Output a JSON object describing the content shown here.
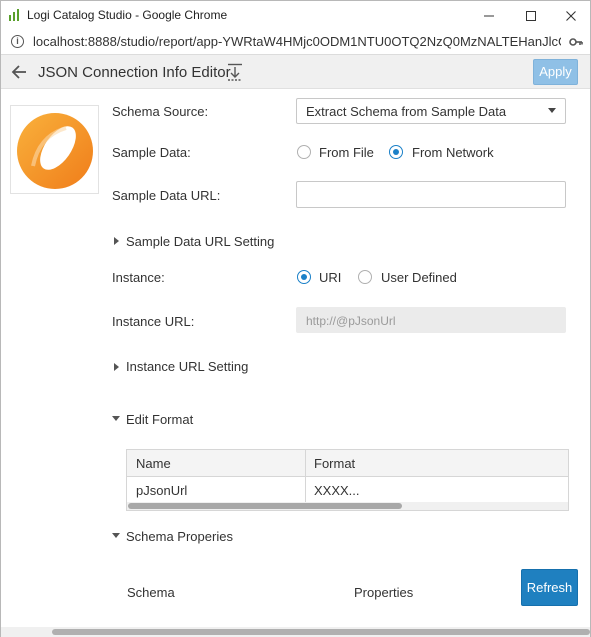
{
  "window": {
    "title": "Logi Catalog Studio - Google Chrome",
    "minimize_icon": "minimize-icon",
    "maximize_icon": "maximize-icon",
    "close_icon": "close-icon"
  },
  "address_bar": {
    "url": "localhost:8888/studio/report/app-YWRtaW4HMjc0ODM1NTU0OTQ2NzQ0MzNALTEHanJlcG9yd...",
    "info_icon": "info-icon",
    "key_icon": "key-icon"
  },
  "toolbar": {
    "title": "JSON Connection Info Editor",
    "back_icon": "back-arrow-icon",
    "download_icon": "download-icon",
    "apply_label": "Apply"
  },
  "form": {
    "schema_source_label": "Schema Source:",
    "schema_source_value": "Extract Schema from Sample Data",
    "sample_data_label": "Sample Data:",
    "sample_data_options": [
      "From File",
      "From Network"
    ],
    "sample_data_selected": "From Network",
    "sample_data_url_label": "Sample Data URL:",
    "sample_data_url_value": "",
    "sample_data_url_setting_label": "Sample Data URL Setting",
    "instance_label": "Instance:",
    "instance_options": [
      "URI",
      "User Defined"
    ],
    "instance_selected": "URI",
    "instance_url_label": "Instance URL:",
    "instance_url_value": "http://@pJsonUrl",
    "instance_url_setting_label": "Instance URL Setting",
    "edit_format_label": "Edit Format",
    "schema_properties_label": "Schema Properies"
  },
  "format_grid": {
    "columns": [
      "Name",
      "Format"
    ],
    "rows": [
      [
        "pJsonUrl",
        "XXXX..."
      ]
    ]
  },
  "schema_section": {
    "schema_label": "Schema",
    "properties_label": "Properties",
    "refresh_label": "Refresh"
  },
  "colors": {
    "accent": "#1f80c0",
    "apply_disabled": "#8fc0e6",
    "logo_orange": "#f7931e"
  }
}
